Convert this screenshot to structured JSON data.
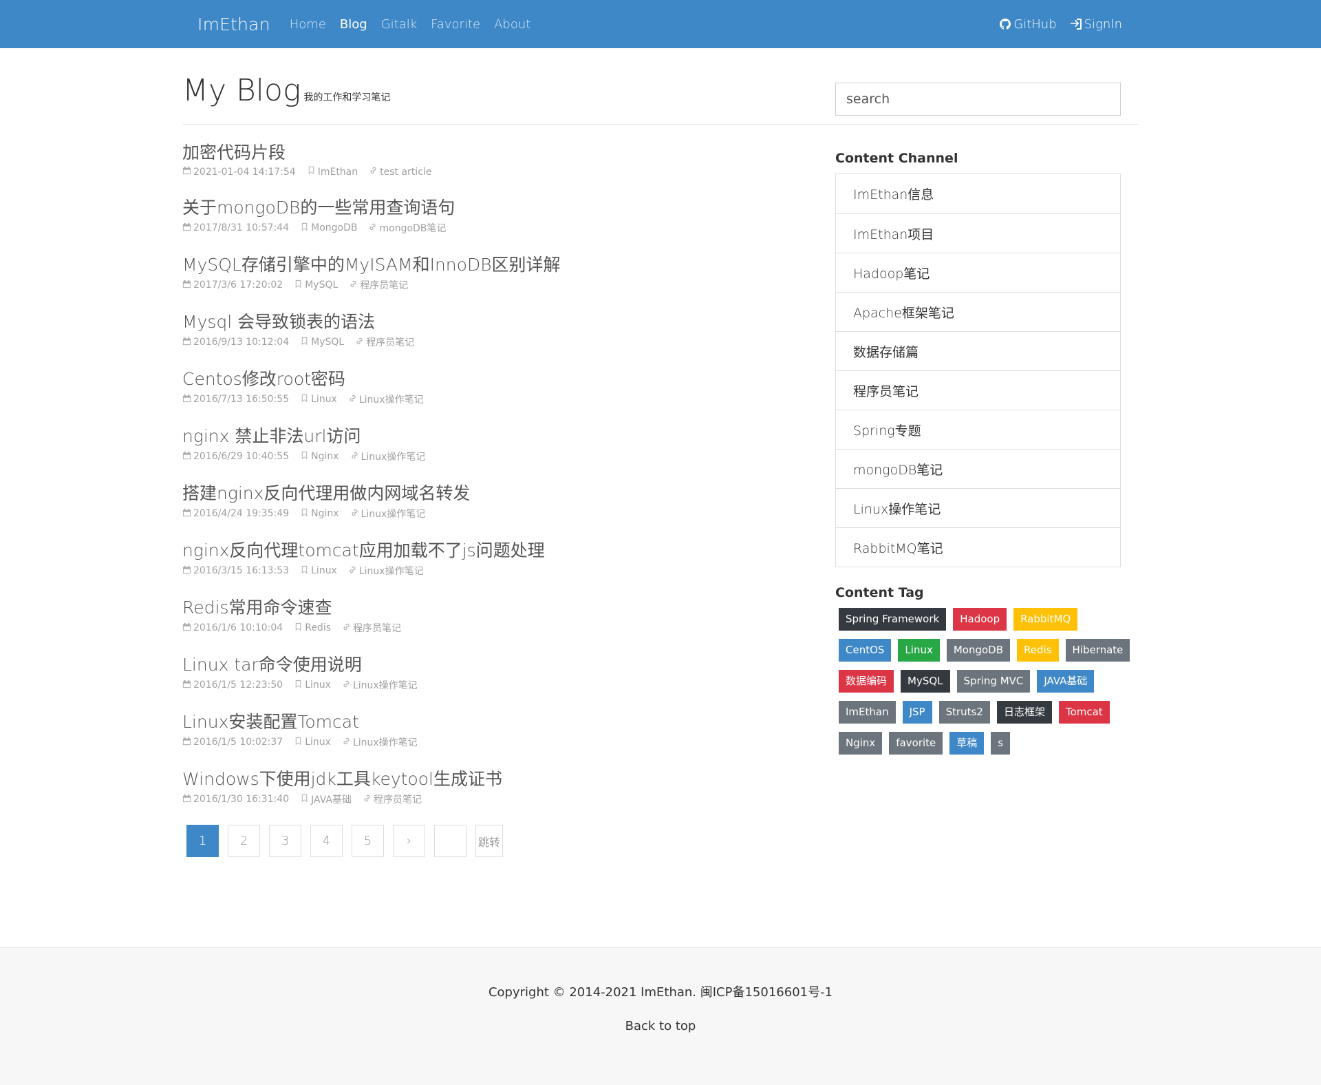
{
  "nav": {
    "brand": "ImEthan",
    "links": [
      "Home",
      "Blog",
      "Gitalk",
      "Favorite",
      "About"
    ],
    "active": "Blog",
    "github": "GitHub",
    "signin": "SignIn"
  },
  "header": {
    "title": "My Blog",
    "subtitle": "我的工作和学习笔记",
    "search_placeholder": "search"
  },
  "posts": [
    {
      "title": "加密代码片段",
      "date": "2021-01-04 14:17:54",
      "tag": "ImEthan",
      "category": "test article"
    },
    {
      "title": "关于mongoDB的一些常用查询语句",
      "date": "2017/8/31 10:57:44",
      "tag": "MongoDB",
      "category": "mongoDB笔记"
    },
    {
      "title": "MySQL存储引擎中的MyISAM和InnoDB区别详解",
      "date": "2017/3/6 17:20:02",
      "tag": "MySQL",
      "category": "程序员笔记"
    },
    {
      "title": "Mysql 会导致锁表的语法",
      "date": "2016/9/13 10:12:04",
      "tag": "MySQL",
      "category": "程序员笔记"
    },
    {
      "title": "Centos修改root密码",
      "date": "2016/7/13 16:50:55",
      "tag": "Linux",
      "category": "Linux操作笔记"
    },
    {
      "title": "nginx 禁止非法url访问",
      "date": "2016/6/29 10:40:55",
      "tag": "Nginx",
      "category": "Linux操作笔记"
    },
    {
      "title": "搭建nginx反向代理用做内网域名转发",
      "date": "2016/4/24 19:35:49",
      "tag": "Nginx",
      "category": "Linux操作笔记"
    },
    {
      "title": "nginx反向代理tomcat应用加载不了js问题处理",
      "date": "2016/3/15 16:13:53",
      "tag": "Linux",
      "category": "Linux操作笔记"
    },
    {
      "title": "Redis常用命令速查",
      "date": "2016/1/6 10:10:04",
      "tag": "Redis",
      "category": "程序员笔记"
    },
    {
      "title": "Linux tar命令使用说明",
      "date": "2016/1/5 12:23:50",
      "tag": "Linux",
      "category": "Linux操作笔记"
    },
    {
      "title": "Linux安装配置Tomcat",
      "date": "2016/1/5 10:02:37",
      "tag": "Linux",
      "category": "Linux操作笔记"
    },
    {
      "title": "Windows下使用jdk工具keytool生成证书",
      "date": "2016/1/30 16:31:40",
      "tag": "JAVA基础",
      "category": "程序员笔记"
    }
  ],
  "pagination": {
    "pages": [
      "1",
      "2",
      "3",
      "4",
      "5"
    ],
    "current": "1",
    "next": "›",
    "jump_value": "",
    "jump_label": "跳转"
  },
  "sidebar": {
    "channel_heading": "Content Channel",
    "channels": [
      "ImEthan信息",
      "ImEthan项目",
      "Hadoop笔记",
      "Apache框架笔记",
      "数据存储篇",
      "程序员笔记",
      "Spring专题",
      "mongoDB笔记",
      "Linux操作笔记",
      "RabbitMQ笔记"
    ],
    "tag_heading": "Content Tag",
    "tags": [
      {
        "label": "Spring Framework",
        "color": "#343a40"
      },
      {
        "label": "Hadoop",
        "color": "#dc3545"
      },
      {
        "label": "RabbitMQ",
        "color": "#ffc107"
      },
      {
        "label": "CentOS",
        "color": "#3f88c8"
      },
      {
        "label": "Linux",
        "color": "#28a745"
      },
      {
        "label": "MongoDB",
        "color": "#6c757d"
      },
      {
        "label": "Redis",
        "color": "#ffc107"
      },
      {
        "label": "Hibernate",
        "color": "#6c757d"
      },
      {
        "label": "数据编码",
        "color": "#dc3545"
      },
      {
        "label": "MySQL",
        "color": "#343a40"
      },
      {
        "label": "Spring MVC",
        "color": "#6c757d"
      },
      {
        "label": "JAVA基础",
        "color": "#3f88c8"
      },
      {
        "label": "ImEthan",
        "color": "#6c757d"
      },
      {
        "label": "JSP",
        "color": "#3f88c8"
      },
      {
        "label": "Struts2",
        "color": "#6c757d"
      },
      {
        "label": "日志框架",
        "color": "#343a40"
      },
      {
        "label": "Tomcat",
        "color": "#dc3545"
      },
      {
        "label": "Nginx",
        "color": "#6c757d"
      },
      {
        "label": "favorite",
        "color": "#6c757d"
      },
      {
        "label": "草稿",
        "color": "#3f88c8"
      },
      {
        "label": "s",
        "color": "#6c757d"
      }
    ]
  },
  "footer": {
    "copyright": "Copyright © 2014-2021 ImEthan. 闽ICP备15016601号-1",
    "back_to_top": "Back to top"
  }
}
